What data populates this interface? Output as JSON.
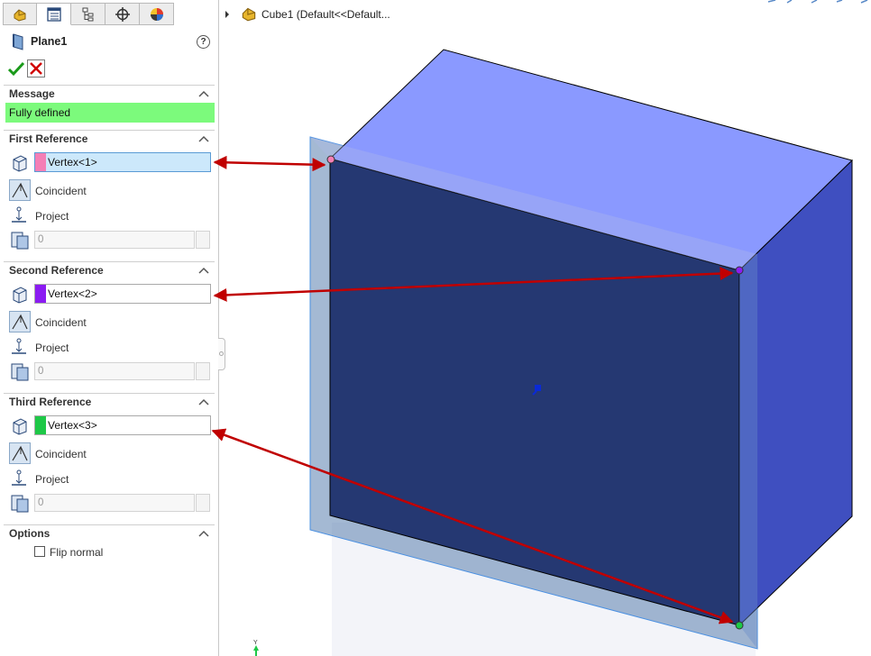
{
  "tabs": [
    {
      "icon": "feature-manager-icon"
    },
    {
      "icon": "property-manager-icon",
      "active": true
    },
    {
      "icon": "configuration-manager-icon"
    },
    {
      "icon": "dimxpert-manager-icon"
    },
    {
      "icon": "display-manager-icon"
    }
  ],
  "header": {
    "title": "Plane1",
    "icon": "plane-icon",
    "help": "?"
  },
  "actions": {
    "ok_icon": "checkmark-icon",
    "cancel_icon": "close-icon"
  },
  "message": {
    "title": "Message",
    "text": "Fully defined",
    "color": "#7cfa7c"
  },
  "references": [
    {
      "title": "First Reference",
      "value": "Vertex<1>",
      "color": "#f47fb6",
      "coincident": "Coincident",
      "project": "Project",
      "distance": "0"
    },
    {
      "title": "Second Reference",
      "value": "Vertex<2>",
      "color": "#8b1cf2",
      "coincident": "Coincident",
      "project": "Project",
      "distance": "0"
    },
    {
      "title": "Third Reference",
      "value": "Vertex<3>",
      "color": "#1ec847",
      "coincident": "Coincident",
      "project": "Project",
      "distance": "0"
    }
  ],
  "options": {
    "title": "Options",
    "flip_label": "Flip normal",
    "flip_checked": false
  },
  "tree": {
    "label": "Cube1  (Default<<Default..."
  },
  "viewport": {
    "axis_label": "Y"
  },
  "colors": {
    "accent_blue": "#5a9bd5",
    "cube_top": "#8a99ff",
    "cube_front": "#2a3a7a",
    "cube_side": "#3f4fc0",
    "arrow": "#c00000"
  }
}
